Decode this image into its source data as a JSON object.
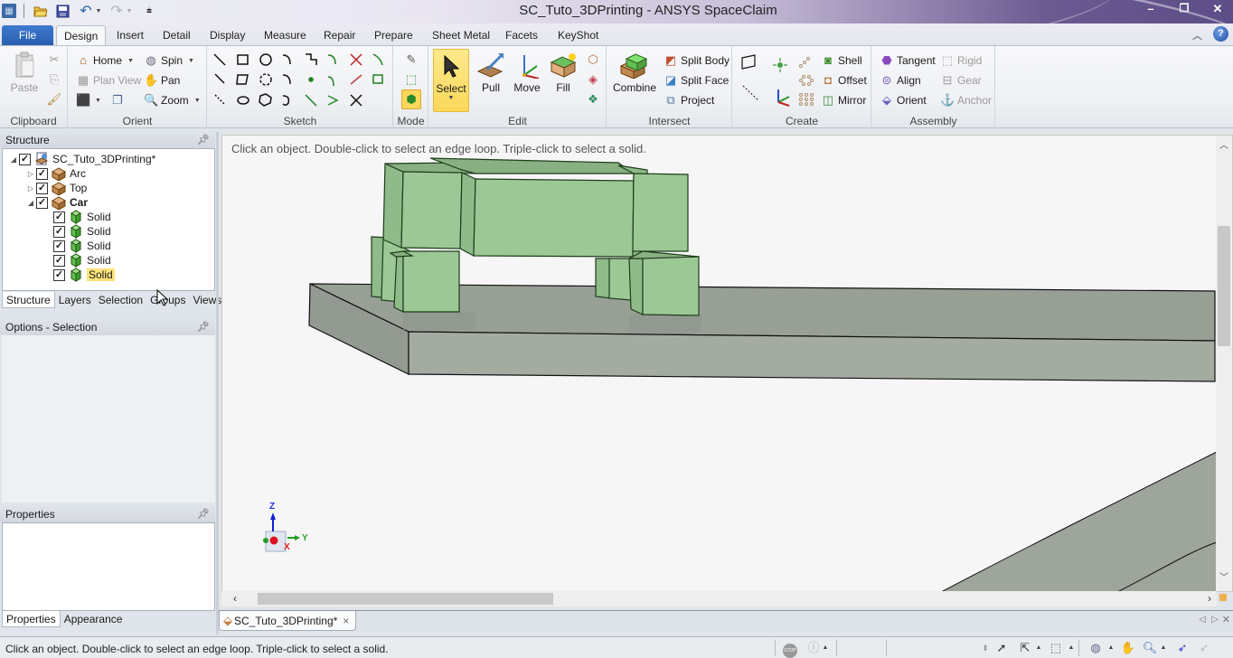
{
  "window": {
    "title": "SC_Tuto_3DPrinting - ANSYS SpaceClaim",
    "controls": {
      "minimize": "–",
      "restore": "❐",
      "close": "✕"
    }
  },
  "quick_access": [
    {
      "name": "app-menu-icon",
      "glyph": "▦"
    },
    {
      "name": "open-icon",
      "glyph": "📂"
    },
    {
      "name": "save-icon",
      "glyph": "💾"
    },
    {
      "name": "undo-icon",
      "glyph": "↶"
    },
    {
      "name": "redo-icon",
      "glyph": "↷"
    },
    {
      "name": "customize-icon",
      "glyph": "⩧"
    }
  ],
  "ribbon_tabs": [
    "File",
    "Design",
    "Insert",
    "Detail",
    "Display",
    "Measure",
    "Repair",
    "Prepare",
    "Sheet Metal",
    "Facets",
    "KeyShot"
  ],
  "active_tab": "Design",
  "ribbon": {
    "clipboard": {
      "label": "Clipboard",
      "paste": "Paste"
    },
    "orient": {
      "label": "Orient",
      "home": "Home",
      "spin": "Spin",
      "plan_view": "Plan View",
      "pan": "Pan",
      "zoom": "Zoom"
    },
    "sketch": {
      "label": "Sketch"
    },
    "mode": {
      "label": "Mode"
    },
    "edit": {
      "label": "Edit",
      "select": "Select",
      "pull": "Pull",
      "move": "Move",
      "fill": "Fill"
    },
    "intersect": {
      "label": "Intersect",
      "combine": "Combine",
      "split_body": "Split Body",
      "split_face": "Split Face",
      "project": "Project"
    },
    "create": {
      "label": "Create",
      "shell": "Shell",
      "offset": "Offset",
      "mirror": "Mirror"
    },
    "assembly": {
      "label": "Assembly",
      "tangent": "Tangent",
      "align": "Align",
      "orient": "Orient",
      "rigid": "Rigid",
      "gear": "Gear",
      "anchor": "Anchor"
    }
  },
  "structure_panel": {
    "title": "Structure",
    "tree": [
      {
        "label": "SC_Tuto_3DPrinting*",
        "level": 0,
        "expanded": true,
        "checked": true,
        "type": "document"
      },
      {
        "label": "Arc",
        "level": 1,
        "expanded": false,
        "checked": true,
        "type": "component"
      },
      {
        "label": "Top",
        "level": 1,
        "expanded": false,
        "checked": true,
        "type": "component"
      },
      {
        "label": "Car",
        "level": 1,
        "expanded": true,
        "checked": true,
        "type": "component",
        "bold": true
      },
      {
        "label": "Solid",
        "level": 2,
        "checked": true,
        "type": "solid"
      },
      {
        "label": "Solid",
        "level": 2,
        "checked": true,
        "type": "solid"
      },
      {
        "label": "Solid",
        "level": 2,
        "checked": true,
        "type": "solid"
      },
      {
        "label": "Solid",
        "level": 2,
        "checked": true,
        "type": "solid"
      },
      {
        "label": "Solid",
        "level": 2,
        "checked": true,
        "type": "solid",
        "highlighted": true
      }
    ],
    "tabs": [
      "Structure",
      "Layers",
      "Selection",
      "Groups",
      "Views"
    ],
    "active_tab": "Structure"
  },
  "options_panel": {
    "title": "Options - Selection"
  },
  "properties_panel": {
    "title": "Properties",
    "tabs": [
      "Properties",
      "Appearance"
    ],
    "active_tab": "Properties"
  },
  "viewport": {
    "hint": "Click an object. Double-click to select an edge loop. Triple-click to select a solid.",
    "triad": {
      "x": "X",
      "y": "Y",
      "z": "Z"
    },
    "colors": {
      "solid": "#9cc895",
      "solid_edge": "#1e3d1a",
      "base": "#98a096",
      "base_front": "#a4aca2"
    }
  },
  "document_tab": {
    "label": "SC_Tuto_3DPrinting*",
    "close": "×"
  },
  "status_bar": {
    "message": "Click an object. Double-click to select an edge loop. Triple-click to select a solid."
  },
  "doc_nav": {
    "prev": "◁",
    "next": "▷",
    "close": "✕"
  }
}
